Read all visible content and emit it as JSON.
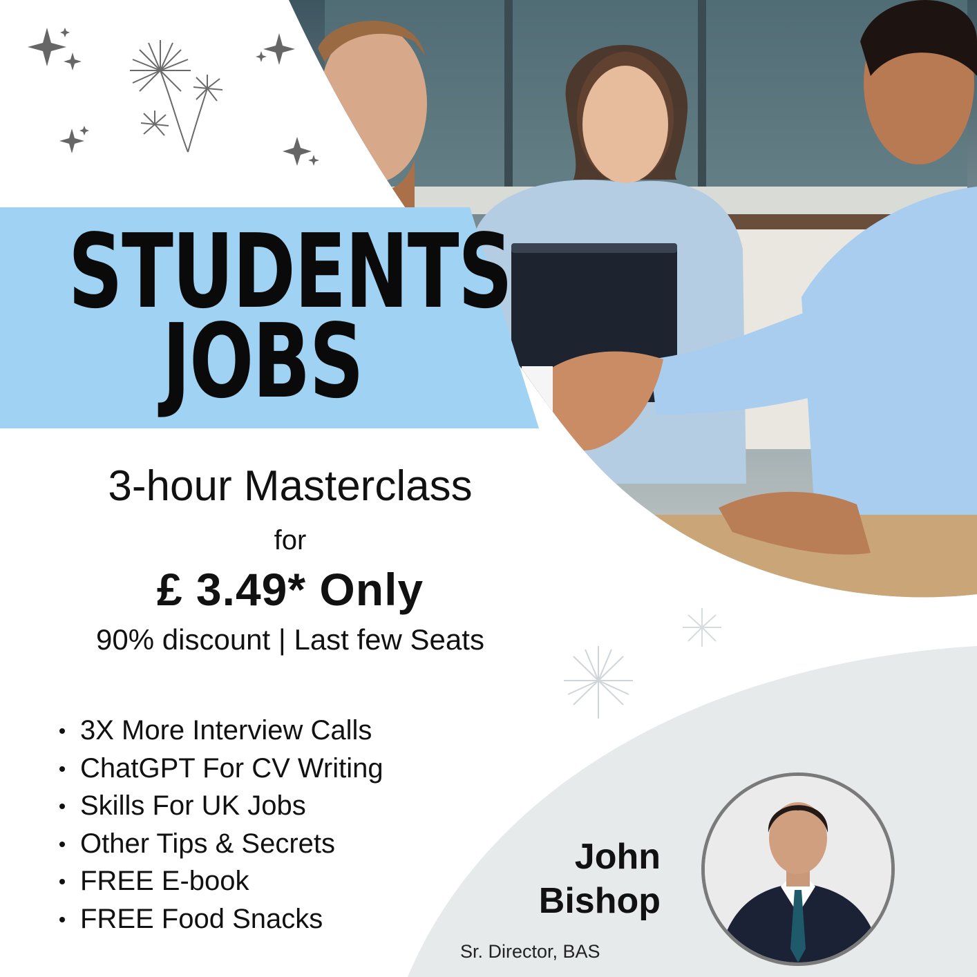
{
  "title": {
    "line1": "STUDENTS",
    "line2": "JOBS"
  },
  "offer": {
    "headline": "3-hour Masterclass",
    "connector": "for",
    "price": "£ 3.49* Only",
    "discount": "90% discount | Last few Seats"
  },
  "features": [
    "3X More Interview Calls",
    "ChatGPT For CV Writing",
    "Skills For UK Jobs",
    "Other Tips & Secrets",
    "FREE E-book",
    "FREE Food Snacks"
  ],
  "speaker": {
    "first_name": "John",
    "last_name": "Bishop",
    "role": "Sr. Director, BAS"
  },
  "colors": {
    "banner": "#9fd2f3",
    "accent_grey": "#e6eaeb",
    "text": "#111111"
  },
  "icons": [
    "sparkle-icon",
    "firework-icon",
    "handshake-photo",
    "speaker-portrait"
  ]
}
